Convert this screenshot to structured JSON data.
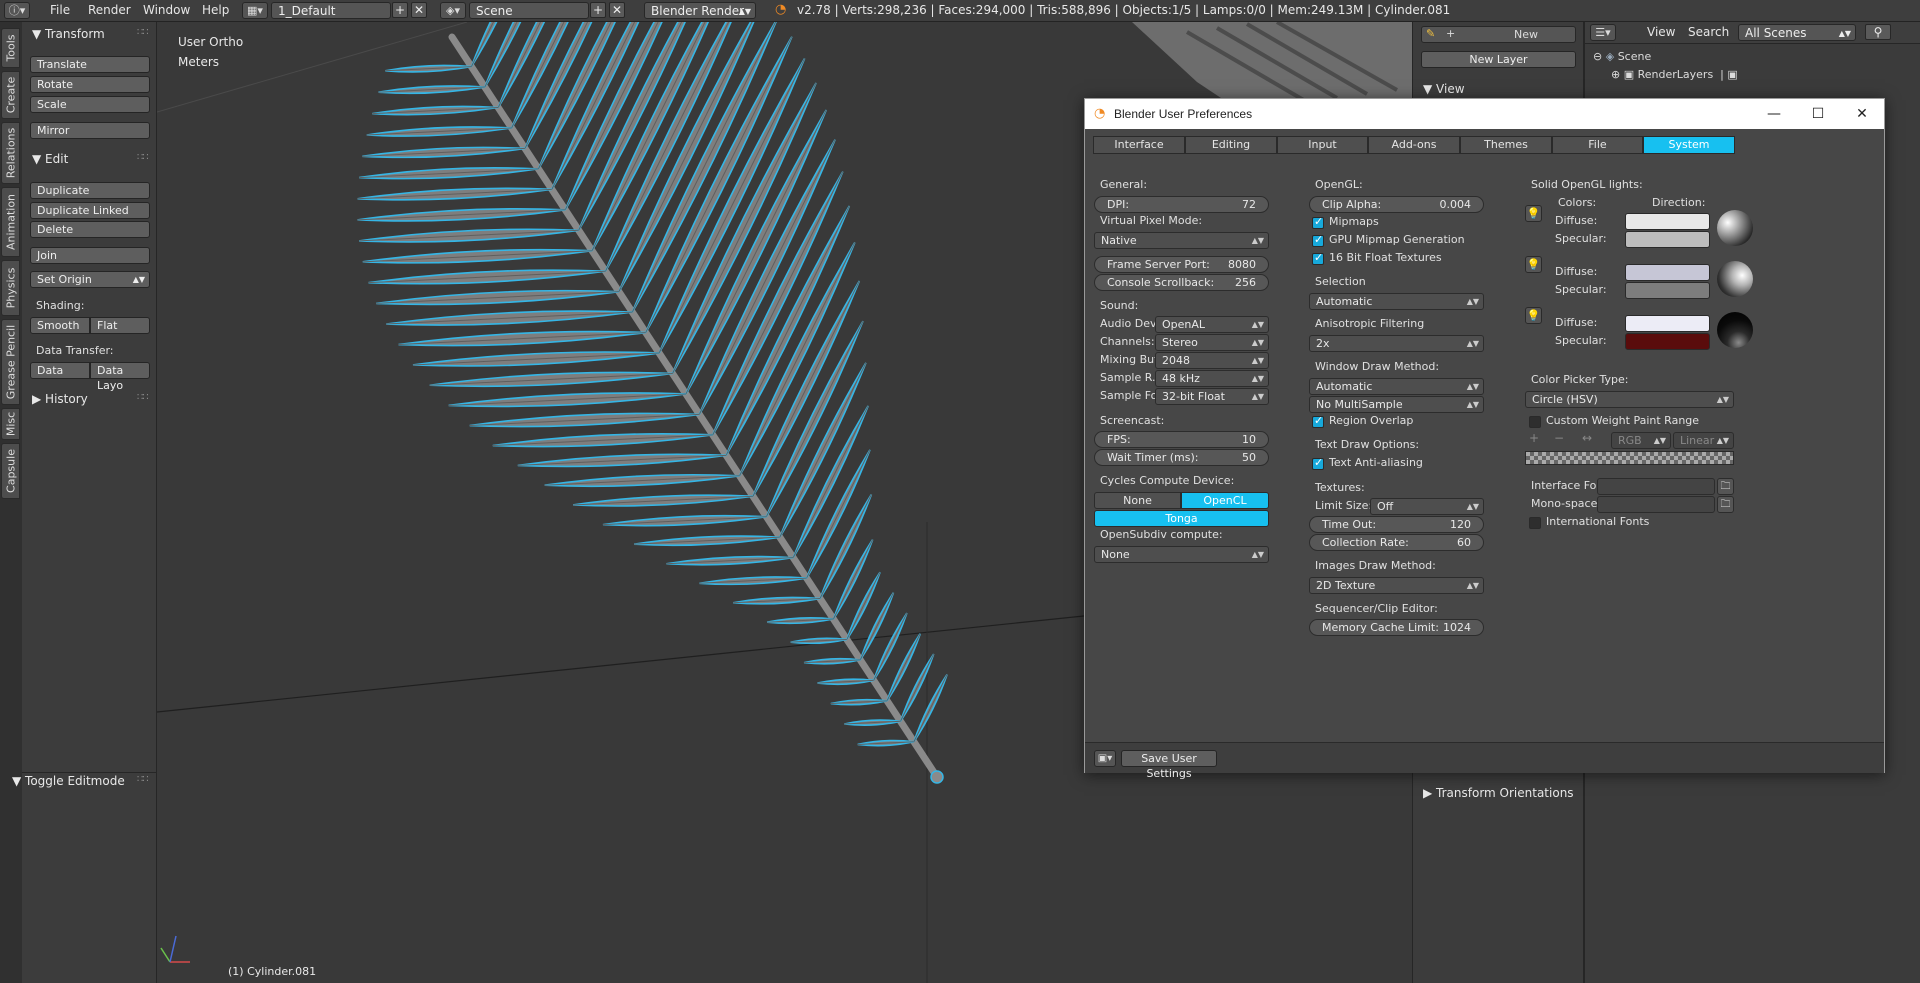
{
  "topbar": {
    "menus": [
      "File",
      "Render",
      "Window",
      "Help"
    ],
    "screen_layout": "1_Default",
    "scene": "Scene",
    "engine": "Blender Render",
    "stats": "v2.78 | Verts:298,236 | Faces:294,000 | Tris:588,896 | Objects:1/5 | Lamps:0/0 | Mem:249.13M | Cylinder.081"
  },
  "vertical_tabs": [
    "Tools",
    "Create",
    "Relations",
    "Animation",
    "Physics",
    "Grease Pencil",
    "Misc",
    "Capsule"
  ],
  "toolshelf": {
    "transform_header": "Transform",
    "translate": "Translate",
    "rotate": "Rotate",
    "scale": "Scale",
    "mirror": "Mirror",
    "edit_header": "Edit",
    "duplicate": "Duplicate",
    "duplicate_linked": "Duplicate Linked",
    "delete": "Delete",
    "join": "Join",
    "set_origin": "Set Origin",
    "shading_label": "Shading:",
    "smooth": "Smooth",
    "flat": "Flat",
    "data_transfer_label": "Data Transfer:",
    "data": "Data",
    "data_layout": "Data Layo",
    "history_header": "History",
    "toggle_editmode": "Toggle Editmode"
  },
  "viewport": {
    "view_name": "User Ortho",
    "units": "Meters",
    "object_label": "(1) Cylinder.081"
  },
  "npanel": {
    "new_label": "New",
    "new_layer": "New Layer",
    "view_header": "View",
    "transform_orientations": "Transform Orientations"
  },
  "outliner": {
    "view": "View",
    "search": "Search",
    "filter": "All Scenes",
    "scene": "Scene",
    "renderlayers": "RenderLayers"
  },
  "prefs": {
    "title": "Blender User Preferences",
    "tabs": [
      "Interface",
      "Editing",
      "Input",
      "Add-ons",
      "Themes",
      "File",
      "System"
    ],
    "active_tab": "System",
    "general": {
      "header": "General:",
      "dpi_label": "DPI:",
      "dpi_value": "72",
      "virtual_pixel_label": "Virtual Pixel Mode:",
      "virtual_pixel_value": "Native",
      "frame_server_label": "Frame Server Port:",
      "frame_server_value": "8080",
      "console_label": "Console Scrollback:",
      "console_value": "256"
    },
    "sound": {
      "header": "Sound:",
      "audio_label": "Audio Dev...",
      "audio_value": "OpenAL",
      "channels_label": "Channels:",
      "channels_value": "Stereo",
      "mixing_label": "Mixing Buf",
      "mixing_value": "2048",
      "rate_label": "Sample R...",
      "rate_value": "48 kHz",
      "format_label": "Sample Fo",
      "format_value": "32-bit Float"
    },
    "screencast": {
      "header": "Screencast:",
      "fps_label": "FPS:",
      "fps_value": "10",
      "wait_label": "Wait Timer (ms):",
      "wait_value": "50"
    },
    "cycles": {
      "header": "Cycles Compute Device:",
      "none": "None",
      "opencl": "OpenCL",
      "device": "Tonga",
      "opensubdiv_header": "OpenSubdiv compute:",
      "opensubdiv_value": "None"
    },
    "opengl": {
      "header": "OpenGL:",
      "clip_label": "Clip Alpha:",
      "clip_value": "0.004",
      "mipmaps": "Mipmaps",
      "gpu_mipmap": "GPU Mipmap Generation",
      "float_textures": "16 Bit Float Textures",
      "selection_header": "Selection",
      "selection_value": "Automatic",
      "aniso_header": "Anisotropic Filtering",
      "aniso_value": "2x",
      "draw_method_header": "Window Draw Method:",
      "draw_method_value": "Automatic",
      "multisample_value": "No MultiSample",
      "region_overlap": "Region Overlap",
      "text_draw_header": "Text Draw Options:",
      "text_aa": "Text Anti-aliasing",
      "textures_header": "Textures:",
      "limit_label": "Limit Size:",
      "limit_value": "Off",
      "timeout_label": "Time Out:",
      "timeout_value": "120",
      "collection_label": "Collection Rate:",
      "collection_value": "60",
      "images_header": "Images Draw Method:",
      "images_value": "2D Texture",
      "seq_header": "Sequencer/Clip Editor:",
      "memcache_label": "Memory Cache Limit:",
      "memcache_value": "1024"
    },
    "lights": {
      "header": "Solid OpenGL lights:",
      "colors": "Colors:",
      "direction": "Direction:",
      "diffuse": "Diffuse:",
      "specular": "Specular:",
      "light_colors": [
        {
          "diffuse": "#e8e8e8",
          "specular": "#bdbdbd"
        },
        {
          "diffuse": "#c6c6d6",
          "specular": "#7d7d7d"
        },
        {
          "diffuse": "#ececf6",
          "specular": "#5a0c0c"
        }
      ]
    },
    "color_picker": {
      "header": "Color Picker Type:",
      "value": "Circle (HSV)",
      "custom_weight": "Custom Weight Paint Range",
      "rgb": "RGB",
      "linear": "Linear"
    },
    "fonts": {
      "interface_label": "Interface Font:",
      "mono_label": "Mono-space ...",
      "international": "International Fonts"
    },
    "save_settings": "Save User Settings"
  },
  "colors": {
    "accent": "#17c0f0",
    "fern_outline": "#35b6e6"
  }
}
